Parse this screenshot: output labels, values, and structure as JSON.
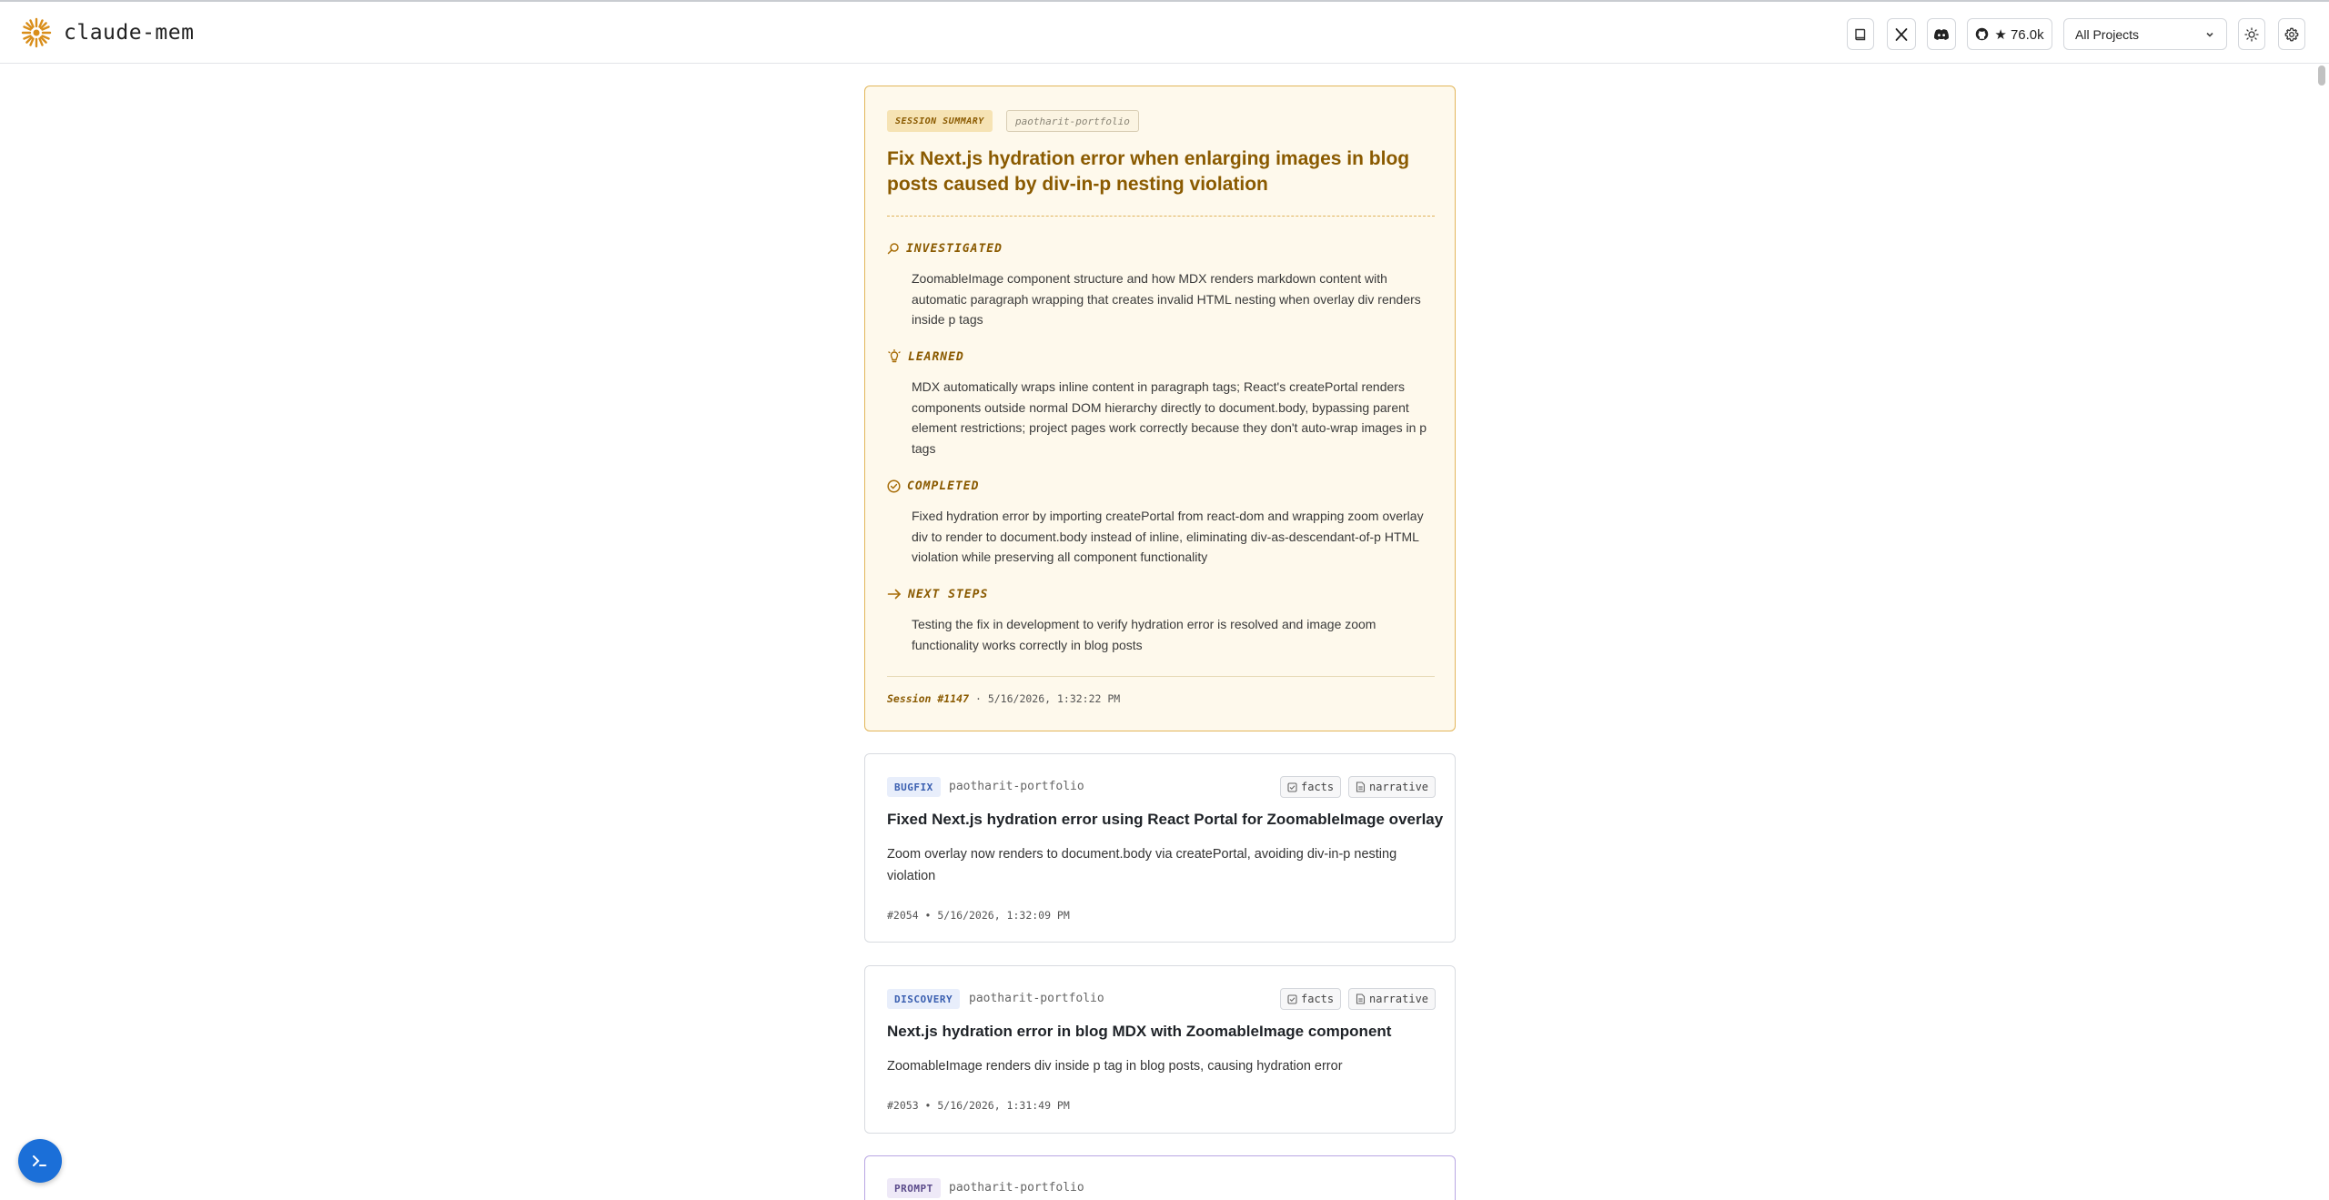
{
  "header": {
    "app_name": "claude-mem",
    "github_stars": "★ 76.0k",
    "project_select": "All Projects"
  },
  "summary": {
    "badge": "SESSION SUMMARY",
    "project": "paotharit-portfolio",
    "title": "Fix Next.js hydration error when enlarging images in blog posts caused by div-in-p nesting violation",
    "sections": [
      {
        "label": "INVESTIGATED",
        "icon": "search-icon",
        "text": "ZoomableImage component structure and how MDX renders markdown content with automatic paragraph wrapping that creates invalid HTML nesting when overlay div renders inside p tags"
      },
      {
        "label": "LEARNED",
        "icon": "lightbulb-icon",
        "text": "MDX automatically wraps inline content in paragraph tags; React's createPortal renders components outside normal DOM hierarchy directly to document.body, bypassing parent element restrictions; project pages work correctly because they don't auto-wrap images in p tags"
      },
      {
        "label": "COMPLETED",
        "icon": "check-circle-icon",
        "text": "Fixed hydration error by importing createPortal from react-dom and wrapping zoom overlay div to render to document.body instead of inline, eliminating div-as-descendant-of-p HTML violation while preserving all component functionality"
      },
      {
        "label": "NEXT STEPS",
        "icon": "arrow-right-icon",
        "text": "Testing the fix in development to verify hydration error is resolved and image zoom functionality works correctly in blog posts"
      }
    ],
    "session_id": "Session #1147",
    "separator": "·",
    "timestamp": "5/16/2026, 1:32:22 PM"
  },
  "observations": [
    {
      "type": "BUGFIX",
      "project": "paotharit-portfolio",
      "facts_label": "facts",
      "narrative_label": "narrative",
      "title": "Fixed Next.js hydration error using React Portal for ZoomableImage overlay",
      "subtitle": "Zoom overlay now renders to document.body via createPortal, avoiding div-in-p nesting violation",
      "meta": "#2054 • 5/16/2026, 1:32:09 PM"
    },
    {
      "type": "DISCOVERY",
      "project": "paotharit-portfolio",
      "facts_label": "facts",
      "narrative_label": "narrative",
      "title": "Next.js hydration error in blog MDX with ZoomableImage component",
      "subtitle": "ZoomableImage renders div inside p tag in blog posts, causing hydration error",
      "meta": "#2053 • 5/16/2026, 1:31:49 PM"
    }
  ],
  "prompt": {
    "type": "PROMPT",
    "project": "paotharit-portfolio"
  },
  "colors": {
    "summary_accent": "#8a5a00",
    "summary_bg": "#fef9ec",
    "summary_border": "#e2b65a",
    "prompt_border": "#b9a7e3",
    "console_button": "#1b6fd8"
  }
}
